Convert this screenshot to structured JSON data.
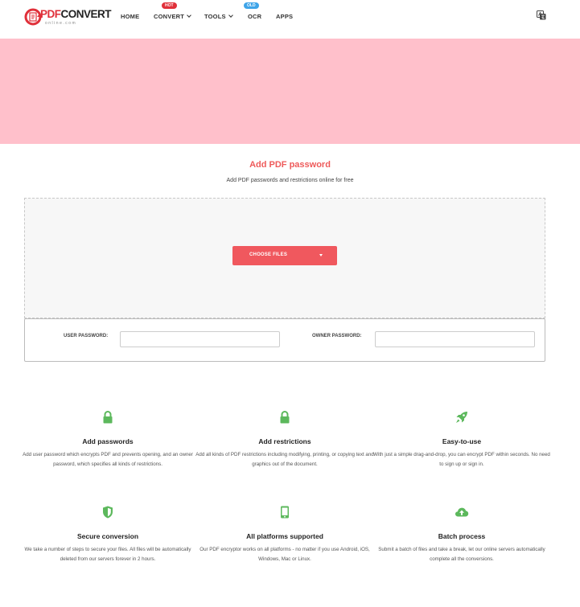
{
  "header": {
    "logo": {
      "brand_pdf": "PDF",
      "brand_convert": "CONVERT",
      "tagline": "online.com"
    },
    "nav": {
      "home": "HOME",
      "convert": "CONVERT",
      "convert_badge": "HOT",
      "tools": "TOOLS",
      "ocr": "OCR",
      "ocr_badge": "OLD",
      "apps": "APPS"
    },
    "language_icon": "translate-icon"
  },
  "hero": {
    "title": "Add PDF password",
    "subtitle": "Add PDF passwords and restrictions online for free"
  },
  "upload": {
    "choose_files_label": "CHOOSE FILES",
    "dropdown_icon": "caret-down-icon"
  },
  "options": {
    "user_password_label": "USER PASSWORD:",
    "user_password_value": "",
    "owner_password_label": "OWNER PASSWORD:",
    "owner_password_value": ""
  },
  "features": [
    {
      "icon": "lock-icon",
      "title": "Add passwords",
      "desc": "Add user password which encrypts PDF and prevents opening, and an owner password, which specifies all kinds of restrictions."
    },
    {
      "icon": "lock-icon",
      "title": "Add restrictions",
      "desc": "Add all kinds of PDF restrictions including modifying, printing, or copying text and graphics out of the document."
    },
    {
      "icon": "rocket-icon",
      "title": "Easy-to-use",
      "desc": "With just a simple drag-and-drop, you can encrypt PDF within seconds. No need to sign up or sign in."
    },
    {
      "icon": "shield-icon",
      "title": "Secure conversion",
      "desc": "We take a number of steps to secure your files. All files will be automatically deleted from our servers forever in 2 hours."
    },
    {
      "icon": "tablet-icon",
      "title": "All platforms supported",
      "desc": "Our PDF encryptor works on all platforms - no matter if you use Android, iOS, Windows, Mac or Linux."
    },
    {
      "icon": "cloud-upload-icon",
      "title": "Batch process",
      "desc": "Submit a batch of files and take a break, let our online servers automatically complete all the conversions."
    }
  ],
  "colors": {
    "accent": "#f0585e",
    "title_red": "#ee5a5a",
    "icon_green": "#5cb85c",
    "ad_banner": "#ffc0cb",
    "badge_hot": "#e0303a",
    "badge_old": "#3ea4e8"
  }
}
